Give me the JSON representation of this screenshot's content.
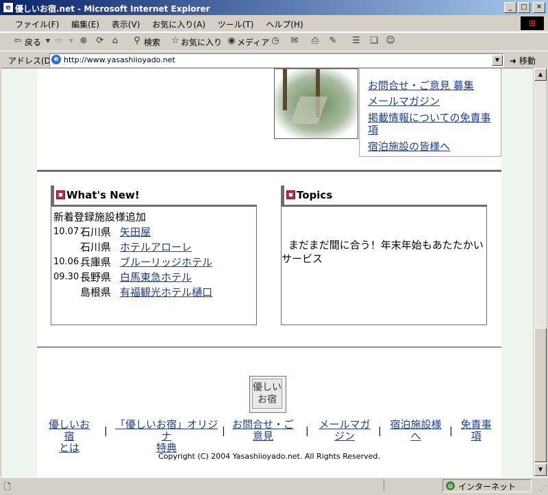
{
  "window": {
    "title": "優しいお宿.net - Microsoft Internet Explorer",
    "app_icon": "e",
    "buttons": {
      "minimize": "_",
      "maximize": "□",
      "close": "✕"
    }
  },
  "menu": [
    "ファイル(F)",
    "編集(E)",
    "表示(V)",
    "お気に入り(A)",
    "ツール(T)",
    "ヘルプ(H)"
  ],
  "toolbar": {
    "back": "戻る",
    "search": "検索",
    "favorites": "お気に入り",
    "media": "メディア"
  },
  "address": {
    "label": "アドレス(D)",
    "url": "http://www.yasashiioyado.net",
    "go": "移動"
  },
  "sidelinks": [
    "お問合せ・ご意見  募集",
    "メールマガジン",
    "掲載情報についての免責事",
    "項",
    "宿泊施設の皆様へ"
  ],
  "whatsnew": {
    "title": "What's New!",
    "intro": "新着登録施設様追加",
    "entries": [
      {
        "date": "10.07",
        "pref": "石川県",
        "name": "矢田屋"
      },
      {
        "date": "",
        "pref": "石川県",
        "name": "ホテルアローレ"
      },
      {
        "date": "10.06",
        "pref": "兵庫県",
        "name": "ブルーリッジホテル"
      },
      {
        "date": "09.30",
        "pref": "長野県",
        "name": "白馬東急ホテル"
      },
      {
        "date": "",
        "pref": "島根県",
        "name": "有福観光ホテル樋口"
      }
    ]
  },
  "topics": {
    "title": "Topics",
    "text": "まだまだ間に合う！年末年始もあたたかいサービス"
  },
  "logo": {
    "line1": "優しい",
    "line2": "お宿"
  },
  "footer": {
    "nav": [
      {
        "l1": "優しいお宿",
        "l2": "とは"
      },
      {
        "l1": "「優しいお宿」オリジナ",
        "l2": "特典"
      },
      {
        "l1": "お問合せ・ご",
        "l2": "意見"
      },
      {
        "l1": "メールマガ",
        "l2": "ジン"
      },
      {
        "l1": "宿泊施設様",
        "l2": "へ"
      },
      {
        "l1": "免責事",
        "l2": "項"
      }
    ],
    "separator": "|",
    "copyright": "Copyright (C) 2004 Yasashiioyado.net. All Rights Reserved."
  },
  "status": {
    "zone": "インターネット"
  }
}
